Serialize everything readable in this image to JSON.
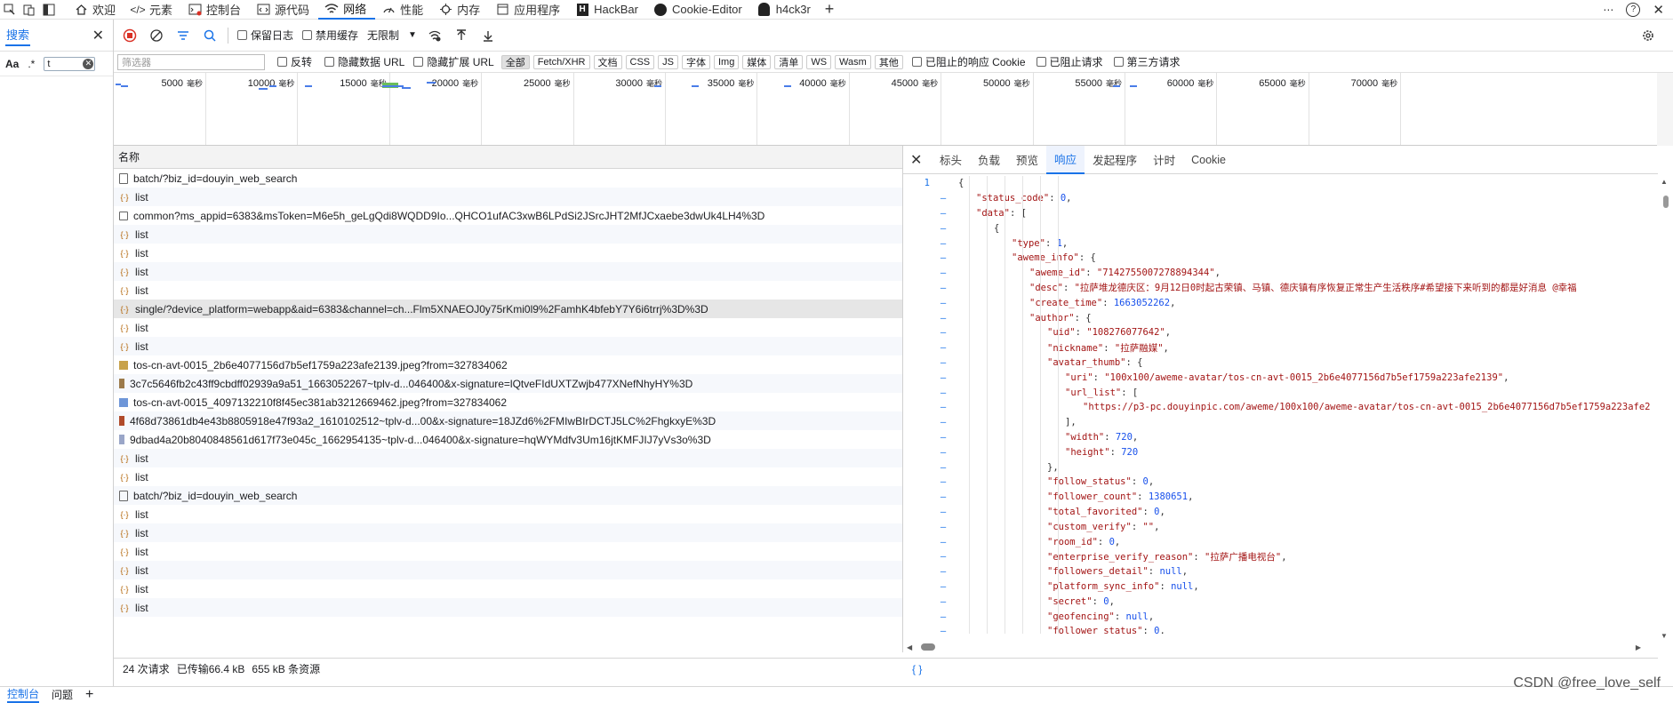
{
  "top_tabs": [
    {
      "label": "欢迎",
      "icon": "home-icon"
    },
    {
      "label": "元素",
      "icon": "elements-icon"
    },
    {
      "label": "控制台",
      "icon": "console-icon"
    },
    {
      "label": "源代码",
      "icon": "sources-icon"
    },
    {
      "label": "网络",
      "icon": "wifi-icon",
      "active": true
    },
    {
      "label": "性能",
      "icon": "performance-icon"
    },
    {
      "label": "内存",
      "icon": "memory-icon"
    },
    {
      "label": "应用程序",
      "icon": "application-icon"
    },
    {
      "label": "HackBar",
      "icon": "hackbar-icon"
    },
    {
      "label": "Cookie-Editor",
      "icon": "cookie-icon"
    },
    {
      "label": "h4ck3r",
      "icon": "h4ck3r-icon"
    }
  ],
  "search": {
    "tab": "搜索",
    "case_label": "Aa",
    "regex_label": ".*",
    "query": "t"
  },
  "toolbar": {
    "preserve_log": "保留日志",
    "disable_cache": "禁用缓存",
    "throttle": "无限制"
  },
  "filter": {
    "placeholder": "筛选器",
    "invert": "反转",
    "hide_data_urls": "隐藏数据 URL",
    "hide_ext_urls": "隐藏扩展 URL",
    "types": [
      "全部",
      "Fetch/XHR",
      "文档",
      "CSS",
      "JS",
      "字体",
      "Img",
      "媒体",
      "清单",
      "WS",
      "Wasm",
      "其他"
    ],
    "blocked_cookies": "已阻止的响应 Cookie",
    "blocked_requests": "已阻止请求",
    "third_party": "第三方请求"
  },
  "timeline": {
    "unit": "毫秒",
    "ticks": [
      "5000",
      "10000",
      "15000",
      "20000",
      "25000",
      "30000",
      "35000",
      "40000",
      "45000",
      "50000",
      "55000",
      "60000",
      "65000",
      "70000"
    ]
  },
  "requests": {
    "header": "名称",
    "rows": [
      {
        "name": "batch/?biz_id=douyin_web_search",
        "type": "doc"
      },
      {
        "name": "list",
        "type": "xhr"
      },
      {
        "name": "common?ms_appid=6383&msToken=M6e5h_geLgQdi8WQDD9Io...QHCO1ufAC3xwB6LPdSi2JSrcJHT2MfJCxaebe3dwUk4LH4%3D",
        "type": "box"
      },
      {
        "name": "list",
        "type": "xhr"
      },
      {
        "name": "list",
        "type": "xhr"
      },
      {
        "name": "list",
        "type": "xhr"
      },
      {
        "name": "list",
        "type": "xhr"
      },
      {
        "name": "single/?device_platform=webapp&aid=6383&channel=ch...Flm5XNAEOJ0y75rKmi0l9%2FamhK4bfebY7Y6i6trrj%3D%3D",
        "type": "xhr",
        "selected": true
      },
      {
        "name": "list",
        "type": "xhr"
      },
      {
        "name": "list",
        "type": "xhr"
      },
      {
        "name": "tos-cn-avt-0015_2b6e4077156d7b5ef1759a223afe2139.jpeg?from=327834062",
        "type": "img"
      },
      {
        "name": "3c7c5646fb2c43ff9cbdff02939a9a51_1663052267~tplv-d...046400&x-signature=lQtveFIdUXTZwjb477XNefNhyHY%3D",
        "type": "img2"
      },
      {
        "name": "tos-cn-avt-0015_4097132210f8f45ec381ab3212669462.jpeg?from=327834062",
        "type": "img3"
      },
      {
        "name": "4f68d73861db4e43b8805918e47f93a2_1610102512~tplv-d...00&x-signature=18JZd6%2FMIwBIrDCTJ5LC%2FhgkxyE%3D",
        "type": "img4"
      },
      {
        "name": "9dbad4a20b8040848561d617f73e045c_1662954135~tplv-d...046400&x-signature=hqWYMdfv3Um16jtKMFJIJ7yVs3o%3D",
        "type": "img5"
      },
      {
        "name": "list",
        "type": "xhr"
      },
      {
        "name": "list",
        "type": "xhr"
      },
      {
        "name": "batch/?biz_id=douyin_web_search",
        "type": "doc"
      },
      {
        "name": "list",
        "type": "xhr"
      },
      {
        "name": "list",
        "type": "xhr"
      },
      {
        "name": "list",
        "type": "xhr"
      },
      {
        "name": "list",
        "type": "xhr"
      },
      {
        "name": "list",
        "type": "xhr"
      },
      {
        "name": "list",
        "type": "xhr"
      }
    ]
  },
  "status": {
    "requests": "24 次请求",
    "transferred": "已传输66.4 kB",
    "resources": "655 kB 条资源"
  },
  "details": {
    "tabs": [
      "标头",
      "负载",
      "预览",
      "响应",
      "发起程序",
      "计时",
      "Cookie"
    ],
    "active_tab": "响应",
    "line_number": "1",
    "lines": [
      {
        "indent": 0,
        "text": "{"
      },
      {
        "indent": 1,
        "key": "\"status_code\"",
        "val": "0",
        "vt": "n",
        "tail": ","
      },
      {
        "indent": 1,
        "key": "\"data\"",
        "val": "[",
        "vt": "p"
      },
      {
        "indent": 2,
        "text": "{"
      },
      {
        "indent": 3,
        "key": "\"type\"",
        "val": "1",
        "vt": "n",
        "tail": ","
      },
      {
        "indent": 3,
        "key": "\"aweme_info\"",
        "val": "{",
        "vt": "p"
      },
      {
        "indent": 4,
        "key": "\"aweme_id\"",
        "val": "\"7142755007278894344\"",
        "vt": "s",
        "tail": ","
      },
      {
        "indent": 4,
        "key": "\"desc\"",
        "val": "\"拉萨堆龙德庆区：9月12日0时起古荣镇、马镇、德庆镇有序恢复正常生产生活秩序#希望接下来听到的都是好消息 @幸福",
        "vt": "s"
      },
      {
        "indent": 4,
        "key": "\"create_time\"",
        "val": "1663052262",
        "vt": "n",
        "tail": ","
      },
      {
        "indent": 4,
        "key": "\"author\"",
        "val": "{",
        "vt": "p"
      },
      {
        "indent": 5,
        "key": "\"uid\"",
        "val": "\"108276077642\"",
        "vt": "s",
        "tail": ","
      },
      {
        "indent": 5,
        "key": "\"nickname\"",
        "val": "\"拉萨融媒\"",
        "vt": "s",
        "tail": ","
      },
      {
        "indent": 5,
        "key": "\"avatar_thumb\"",
        "val": "{",
        "vt": "p"
      },
      {
        "indent": 6,
        "key": "\"uri\"",
        "val": "\"100x100/aweme-avatar/tos-cn-avt-0015_2b6e4077156d7b5ef1759a223afe2139\"",
        "vt": "s",
        "tail": ","
      },
      {
        "indent": 6,
        "key": "\"url_list\"",
        "val": "[",
        "vt": "p"
      },
      {
        "indent": 7,
        "text": "\"https://p3-pc.douyinpic.com/aweme/100x100/aweme-avatar/tos-cn-avt-0015_2b6e4077156d7b5ef1759a223afe2",
        "vt": "s"
      },
      {
        "indent": 6,
        "text": "],"
      },
      {
        "indent": 6,
        "key": "\"width\"",
        "val": "720",
        "vt": "n",
        "tail": ","
      },
      {
        "indent": 6,
        "key": "\"height\"",
        "val": "720",
        "vt": "n"
      },
      {
        "indent": 5,
        "text": "},"
      },
      {
        "indent": 5,
        "key": "\"follow_status\"",
        "val": "0",
        "vt": "n",
        "tail": ","
      },
      {
        "indent": 5,
        "key": "\"follower_count\"",
        "val": "1380651",
        "vt": "n",
        "tail": ","
      },
      {
        "indent": 5,
        "key": "\"total_favorited\"",
        "val": "0",
        "vt": "n",
        "tail": ","
      },
      {
        "indent": 5,
        "key": "\"custom_verify\"",
        "val": "\"\"",
        "vt": "s",
        "tail": ","
      },
      {
        "indent": 5,
        "key": "\"room_id\"",
        "val": "0",
        "vt": "n",
        "tail": ","
      },
      {
        "indent": 5,
        "key": "\"enterprise_verify_reason\"",
        "val": "\"拉萨广播电视台\"",
        "vt": "s",
        "tail": ","
      },
      {
        "indent": 5,
        "key": "\"followers_detail\"",
        "val": "null",
        "vt": "n",
        "tail": ","
      },
      {
        "indent": 5,
        "key": "\"platform_sync_info\"",
        "val": "null",
        "vt": "n",
        "tail": ","
      },
      {
        "indent": 5,
        "key": "\"secret\"",
        "val": "0",
        "vt": "n",
        "tail": ","
      },
      {
        "indent": 5,
        "key": "\"geofencing\"",
        "val": "null",
        "vt": "n",
        "tail": ","
      },
      {
        "indent": 5,
        "key": "\"follower_status\"",
        "val": "0",
        "vt": "n",
        "tail": ","
      }
    ],
    "footer": "{ }"
  },
  "drawer": {
    "tabs": [
      "控制台",
      "问题"
    ]
  },
  "watermark": "CSDN @free_love_self",
  "colors": {
    "accent": "#1a73e8",
    "json_key": "#a31515",
    "json_number": "#1750eb"
  }
}
